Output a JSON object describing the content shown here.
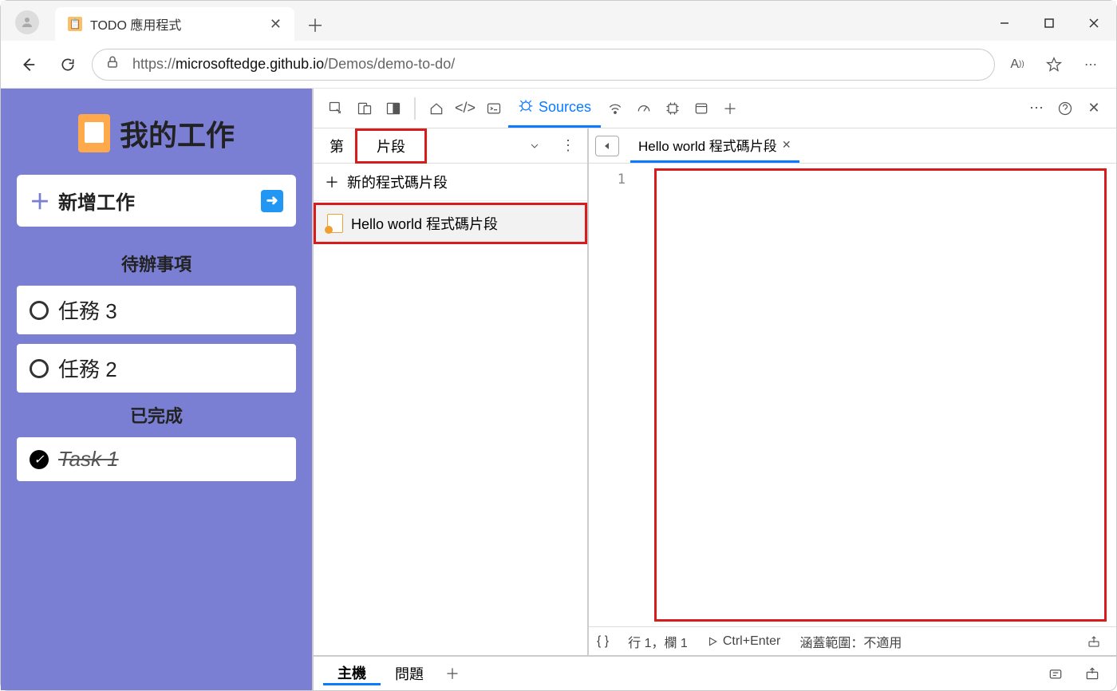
{
  "browser": {
    "tab_title": "TODO 應用程式",
    "url_host": "microsoftedge.github.io",
    "url_prefix": "https://",
    "url_path": "/Demos/demo-to-do/"
  },
  "app": {
    "title": "我的工作",
    "add_label": "新增工作",
    "pending_header": "待辦事項",
    "completed_header": "已完成",
    "tasks_pending": [
      "任務 3",
      "任務 2"
    ],
    "tasks_done": [
      "Task 1"
    ]
  },
  "devtools": {
    "sources_label": "Sources",
    "nav": {
      "tab1": "第",
      "tab2": "片段",
      "new_snippet": "新的程式碼片段",
      "snippet_name": "Hello world 程式碼片段"
    },
    "editor": {
      "file_tab": "Hello world 程式碼片段",
      "line_number": "1"
    },
    "status": {
      "braces": "{ }",
      "position": "行 1，欄 1",
      "run": "Ctrl+Enter",
      "coverage": "涵蓋範圍：不適用"
    },
    "drawer": {
      "tab1": "主機",
      "tab2": "問題"
    }
  }
}
